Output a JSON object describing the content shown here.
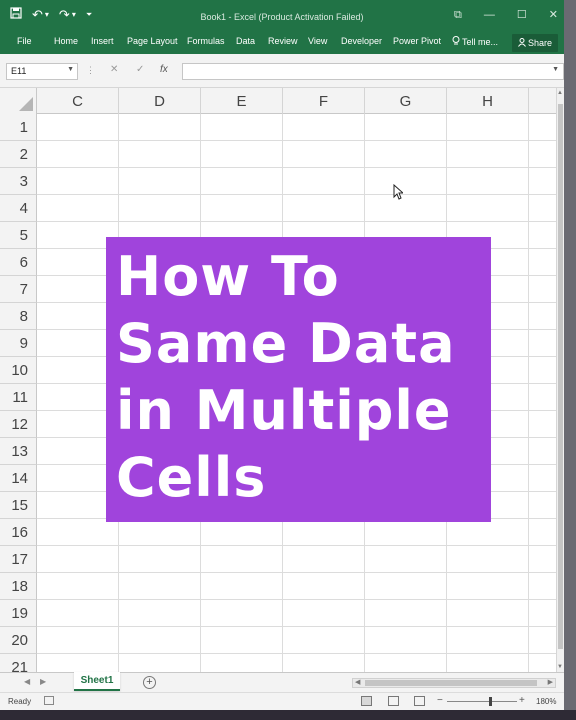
{
  "titlebar": {
    "title": "Book1 - Excel (Product Activation Failed)",
    "qat": {
      "save_icon": "save-icon",
      "undo_glyph": "↶",
      "undo_dd": "▾",
      "redo_glyph": "↷",
      "redo_dd": "▾",
      "customize_glyph": "⏷"
    },
    "window_controls": {
      "ribbon_display": "⧉",
      "minimize": "—",
      "restore": "☐",
      "close": "✕"
    }
  },
  "ribbon": {
    "tabs": [
      "File",
      "Home",
      "Insert",
      "Page Layout",
      "Formulas",
      "Data",
      "Review",
      "View",
      "Developer",
      "Power Pivot"
    ],
    "tell_me": "Tell me...",
    "share": "Share"
  },
  "formula_bar": {
    "name_box": "E11",
    "cancel": "✕",
    "enter": "✓",
    "fx": "fx",
    "value": ""
  },
  "grid": {
    "columns": [
      "C",
      "D",
      "E",
      "F",
      "G",
      "H"
    ],
    "rows": [
      "1",
      "2",
      "3",
      "4",
      "5",
      "6",
      "7",
      "8",
      "9",
      "10",
      "11",
      "12",
      "13",
      "14",
      "15",
      "16",
      "17",
      "18",
      "19",
      "20",
      "21"
    ]
  },
  "overlay": {
    "lines": [
      "How To",
      "Same Data",
      "in Multiple",
      "Cells"
    ],
    "background": "#a044dc",
    "text_color": "#ffffff"
  },
  "sheets": {
    "tabs": [
      "Sheet1"
    ],
    "add": "+"
  },
  "status": {
    "ready": "Ready",
    "zoom": "180%",
    "zoom_minus": "−",
    "zoom_plus": "+"
  },
  "colors": {
    "excel_green": "#217346",
    "purple": "#a044dc"
  }
}
